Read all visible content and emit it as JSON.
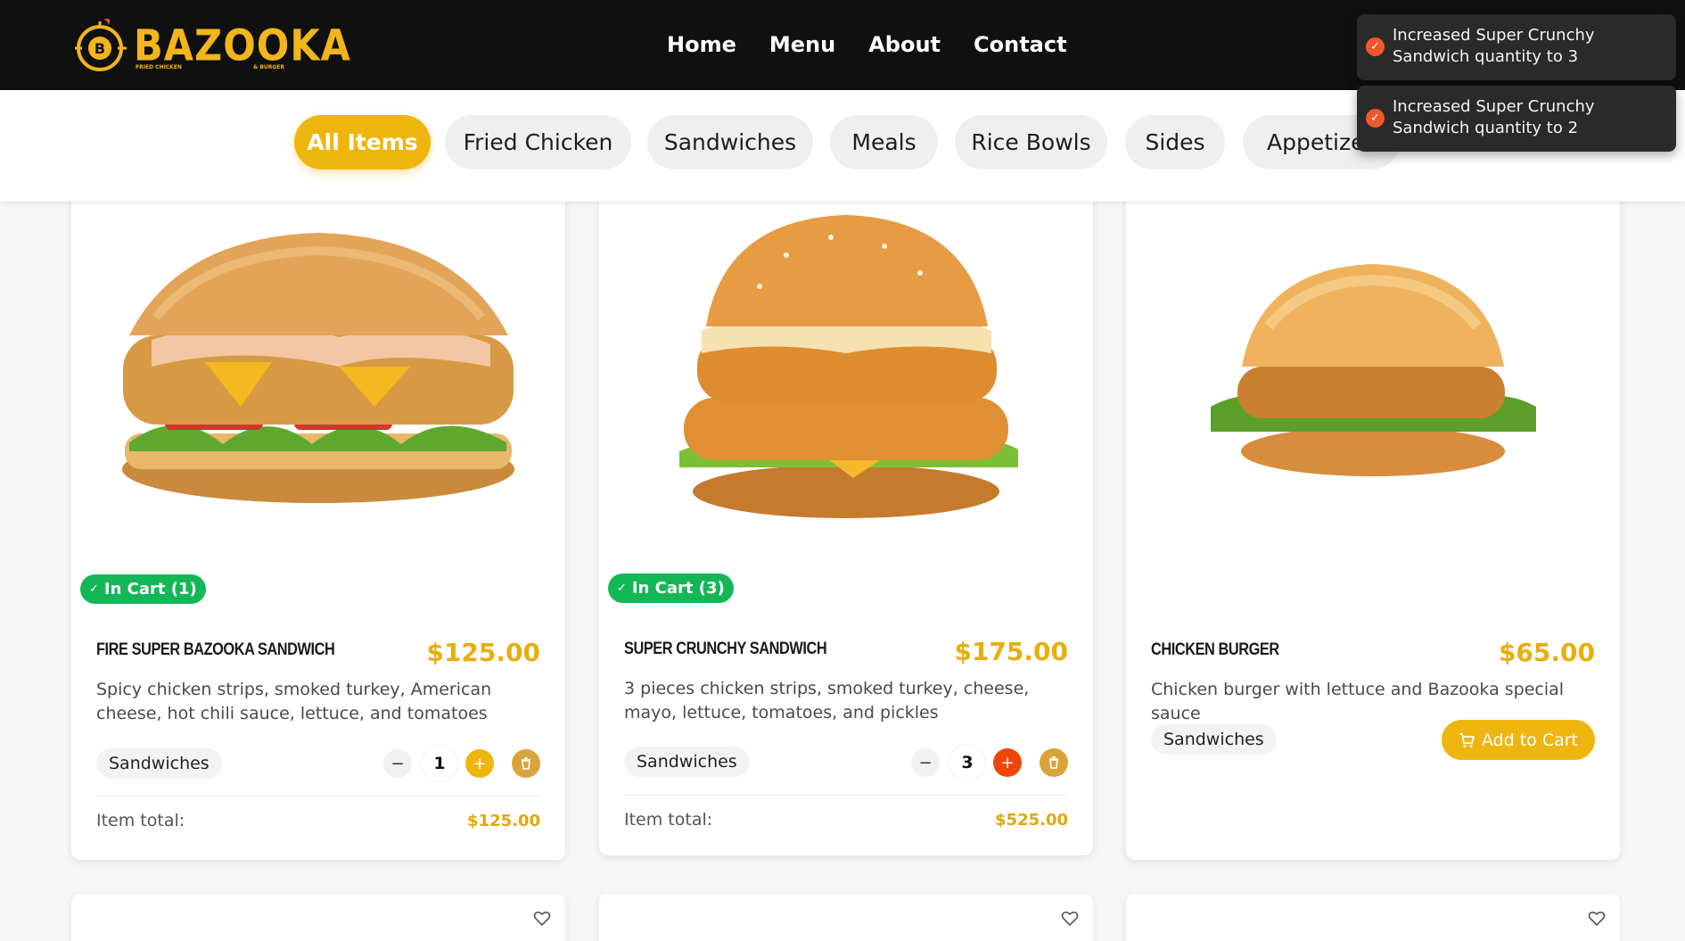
{
  "brand": {
    "name": "BAZOOKA",
    "sub_left": "FRIED CHICKEN",
    "sub_right": "& BURGER",
    "accent": "#efb50f"
  },
  "nav": {
    "links": [
      "Home",
      "Menu",
      "About",
      "Contact"
    ]
  },
  "categories": [
    "All Items",
    "Fried Chicken",
    "Sandwiches",
    "Meals",
    "Rice Bowls",
    "Sides",
    "Appetizers"
  ],
  "active_category": "All Items",
  "toasts": [
    {
      "icon": "check-icon",
      "text": "Increased Super Crunchy Sandwich quantity to 3"
    },
    {
      "icon": "check-icon",
      "text": "Increased Super Crunchy Sandwich quantity to 2"
    }
  ],
  "products": [
    {
      "badge": "In Cart (1)",
      "name": "Fire Super Bazooka Sandwich",
      "price": "$125.00",
      "description": "Spicy chicken strips, smoked turkey, American cheese, hot chili sauce, lettuce, and tomatoes",
      "category": "Sandwiches",
      "quantity": "1",
      "total_label": "Item total:",
      "total": "$125.00"
    },
    {
      "badge": "In Cart (3)",
      "name": "Super Crunchy Sandwich",
      "price": "$175.00",
      "description": "3 pieces chicken strips, smoked turkey, cheese, mayo, lettuce, tomatoes, and pickles",
      "category": "Sandwiches",
      "quantity": "3",
      "total_label": "Item total:",
      "total": "$525.00"
    },
    {
      "name": "Chicken Burger",
      "price": "$65.00",
      "description": "Chicken burger with lettuce and Bazooka special sauce",
      "category": "Sandwiches",
      "add_label": "Add to Cart"
    }
  ],
  "icons": {
    "minus": "−",
    "plus": "+",
    "check": "✓"
  }
}
